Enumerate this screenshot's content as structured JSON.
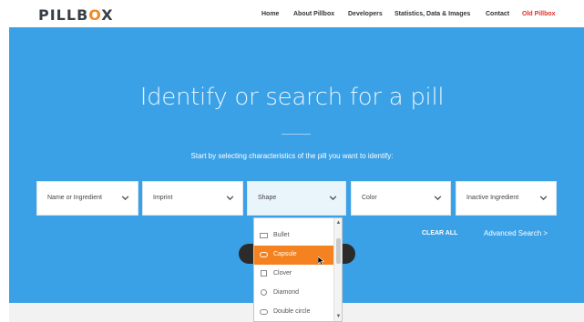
{
  "brand": {
    "logo_pre": "PILLB",
    "logo_o": "O",
    "logo_post": "X"
  },
  "nav": {
    "items": [
      "Home",
      "About Pillbox",
      "Developers",
      "Statistics, Data & Images",
      "Contact"
    ],
    "old": "Old Pillbox"
  },
  "hero": {
    "headline": "Identify or search for a pill",
    "subtitle": "Start by selecting characteristics of the pill you want to identify:"
  },
  "filters": [
    {
      "label": "Name or Ingredient"
    },
    {
      "label": "Imprint"
    },
    {
      "label": "Shape"
    },
    {
      "label": "Color"
    },
    {
      "label": "Inactive Ingredient"
    }
  ],
  "actions": {
    "clear_all": "CLEAR ALL",
    "advanced_search": "Advanced Search >"
  },
  "shape_dropdown": {
    "options": [
      {
        "label": "Bullet",
        "icon": "bullet-icon"
      },
      {
        "label": "Capsule",
        "icon": "capsule-icon",
        "highlighted": true
      },
      {
        "label": "Clover",
        "icon": "clover-icon"
      },
      {
        "label": "Diamond",
        "icon": "diamond-icon"
      },
      {
        "label": "Double circle",
        "icon": "double-circle-icon"
      }
    ]
  },
  "colors": {
    "hero_blue": "#3aa1e6",
    "highlight_orange": "#f58220",
    "old_pillbox_red": "#e0312c"
  }
}
